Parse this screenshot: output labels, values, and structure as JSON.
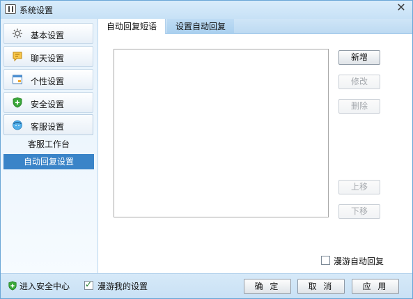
{
  "window": {
    "title": "系统设置",
    "close_glyph": "✕"
  },
  "sidebar": {
    "items": [
      {
        "label": "基本设置",
        "icon": "gear-icon"
      },
      {
        "label": "聊天设置",
        "icon": "chat-bubble-icon"
      },
      {
        "label": "个性设置",
        "icon": "window-icon"
      },
      {
        "label": "安全设置",
        "icon": "shield-plus-icon"
      },
      {
        "label": "客服设置",
        "icon": "customer-service-icon"
      }
    ],
    "sub_items": [
      {
        "label": "客服工作台",
        "selected": false
      },
      {
        "label": "自动回复设置",
        "selected": true
      }
    ]
  },
  "tabs": [
    {
      "label": "自动回复短语",
      "active": true
    },
    {
      "label": "设置自动回复",
      "active": false
    }
  ],
  "buttons": {
    "add": "新增",
    "edit": "修改",
    "delete": "删除",
    "move_up": "上移",
    "move_down": "下移"
  },
  "roaming_auto_reply": {
    "label": "漫游自动回复",
    "checked": false
  },
  "footer": {
    "security_center": "进入安全中心",
    "roam_settings": {
      "label": "漫游我的设置",
      "checked": true
    },
    "ok": "确 定",
    "cancel": "取 消",
    "apply": "应 用"
  },
  "colors": {
    "accent": "#3a84c8",
    "border": "#6aa6d6",
    "shield_green": "#3aa83a"
  }
}
